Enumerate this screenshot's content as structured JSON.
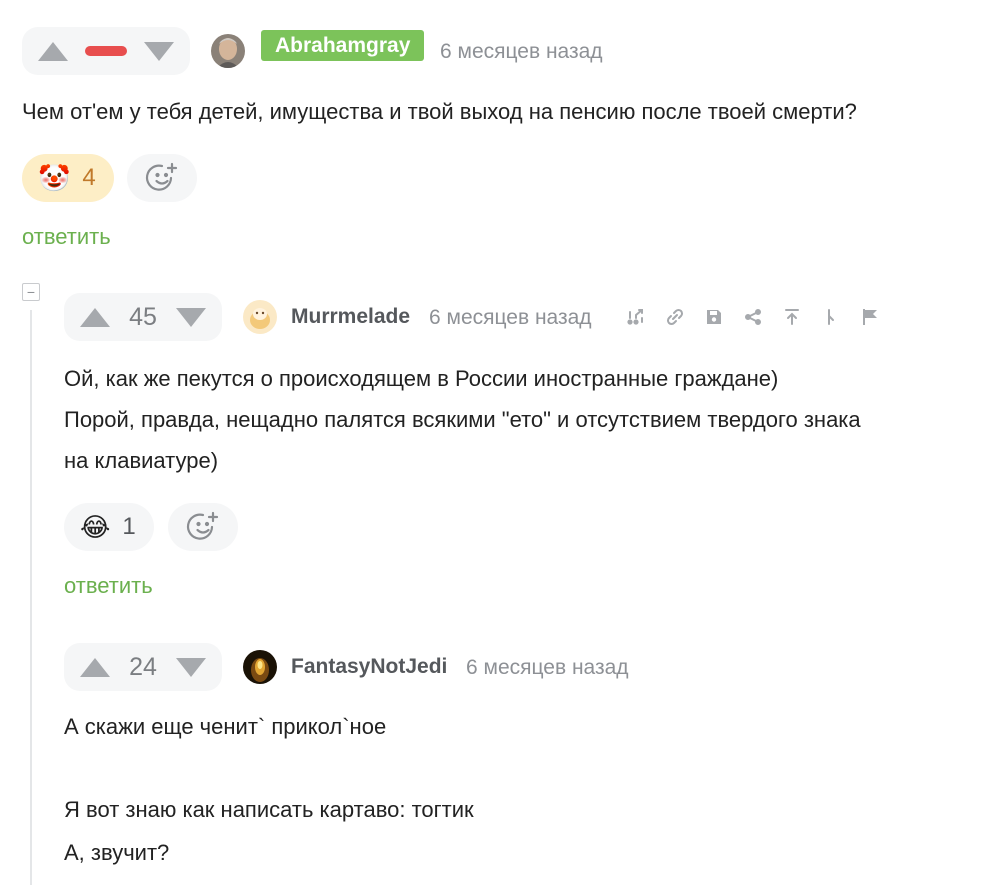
{
  "comments": [
    {
      "user": "Abrahamgray",
      "time": "6 месяцев назад",
      "text": "Чем от'ем у тебя детей, имущества и твой выход на пенсию после твоей смерти?",
      "reaction": {
        "emoji": "🤡",
        "count": "4"
      },
      "reply_label": "ответить"
    },
    {
      "rating": "45",
      "user": "Murrmelade",
      "time": "6 месяцев назад",
      "lines": [
        "Ой, как же пекутся о происходящем в России иностранные граждане)",
        "Порой, правда, нещадно палятся всякими \"ето\" и отсутствием твердого знака",
        "на клавиатуре)"
      ],
      "reaction": {
        "emoji": "😂",
        "count": "1"
      },
      "reply_label": "ответить",
      "collapse_label": "−"
    },
    {
      "rating": "24",
      "user": "FantasyNotJedi",
      "time": "6 месяцев назад",
      "lines": [
        "А скажи еще ченит` прикол`ное",
        "",
        "Я вот знаю как написать картаво: тогтик",
        "А, звучит?"
      ]
    }
  ],
  "icons": {
    "toolbar": [
      "branch-icon",
      "link-icon",
      "save-icon",
      "share-icon",
      "scroll-top-icon",
      "parent-comment-icon",
      "report-flag-icon"
    ],
    "add_reaction": "add-reaction-icon"
  },
  "colors": {
    "accent_green": "#6bb04e",
    "minus_red": "#e84e4e",
    "tag_green": "#7cc35a",
    "clown_bg": "#fdeec6"
  }
}
